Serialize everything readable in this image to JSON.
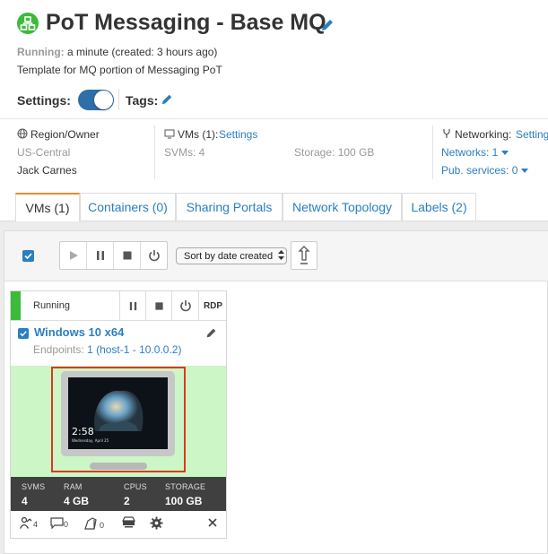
{
  "header": {
    "title": "PoT Messaging - Base MQ",
    "status_label": "Running:",
    "status_text": "a minute (created: 3 hours ago)",
    "description": "Template for MQ portion of Messaging PoT",
    "settings_label": "Settings:",
    "tags_label": "Tags:",
    "settings_toggle_on": true,
    "accent_color": "#2a7fc1",
    "logo_color": "#3cba39"
  },
  "details": {
    "region": {
      "label": "Region/Owner",
      "region": "US-Central",
      "owner": "Jack Carnes"
    },
    "vms": {
      "label": "VMs (1):",
      "link": "Settings",
      "svms": "SVMs: 4",
      "storage": "Storage: 100 GB"
    },
    "networking": {
      "label": "Networking:",
      "link": "Settings",
      "networks": "Networks: 1",
      "pub_services": "Pub. services: 0"
    }
  },
  "tabs": [
    {
      "label": "VMs (1)",
      "active": true
    },
    {
      "label": "Containers (0)",
      "active": false
    },
    {
      "label": "Sharing Portals",
      "active": false
    },
    {
      "label": "Network Topology",
      "active": false
    },
    {
      "label": "Labels (2)",
      "active": false
    }
  ],
  "toolbar": {
    "sort_label": "Sort by date created"
  },
  "vm_card": {
    "status": "Running",
    "status_color": "#3cba39",
    "rdp_label": "RDP",
    "name": "Windows 10 x64",
    "endpoints_label": "Endpoints:",
    "endpoints_value": "1 (host-1 - 10.0.0.2)",
    "screen_time": "2:58",
    "screen_date": "Wednesday, April 25",
    "specs": [
      {
        "label": "SVMS",
        "value": "4"
      },
      {
        "label": "RAM",
        "value": "4 GB"
      },
      {
        "label": "CPUS",
        "value": "2"
      },
      {
        "label": "STORAGE",
        "value": "100 GB"
      }
    ],
    "footer": {
      "users": "4",
      "comments": "0",
      "snapshots": "0"
    }
  }
}
